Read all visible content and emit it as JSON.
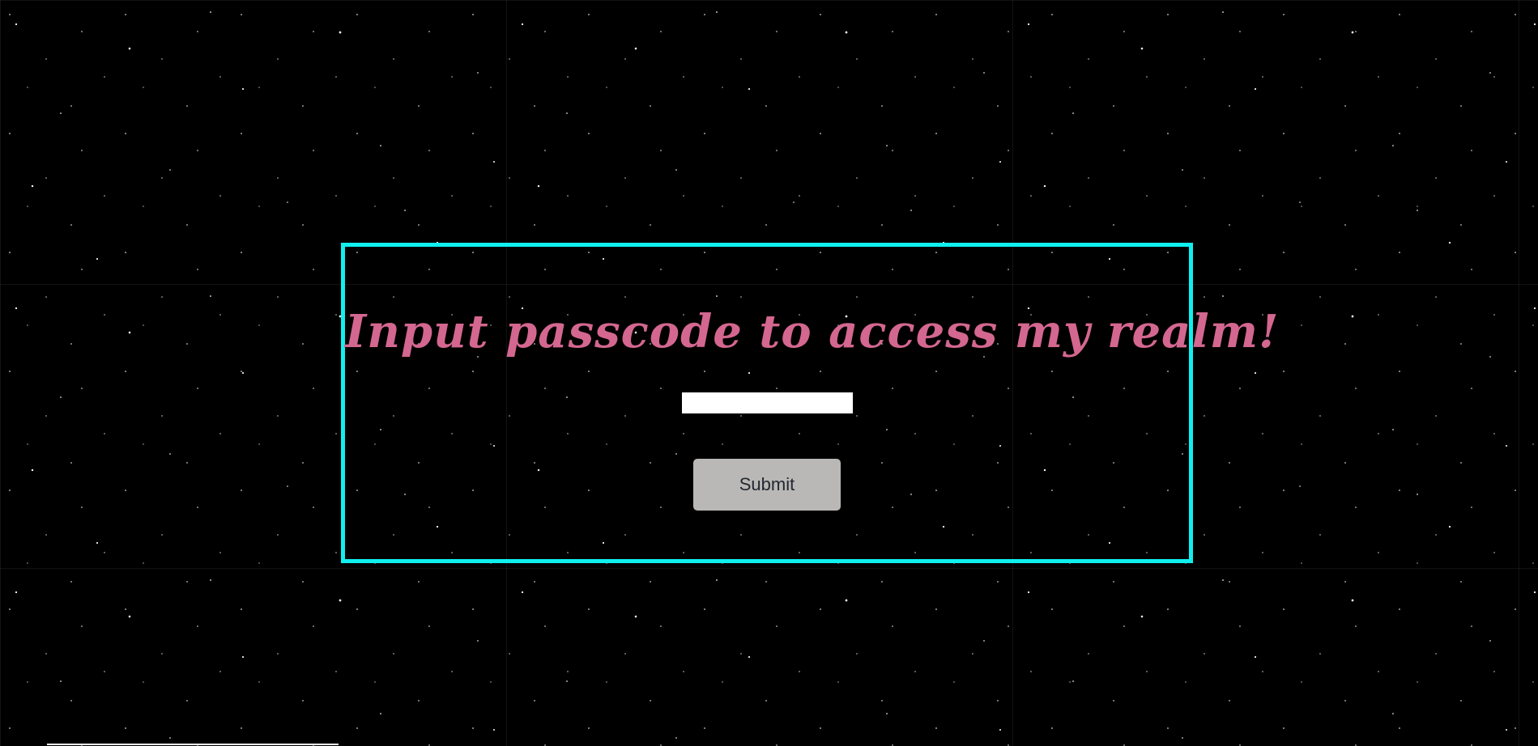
{
  "login": {
    "heading": "Input passcode to access my realm!",
    "passcode_value": "",
    "submit_label": "Submit"
  },
  "colors": {
    "background": "#000000",
    "panel_border": "#0ff0ef",
    "heading_text": "#d4678f",
    "button_background": "#bab8b6",
    "button_text": "#222831"
  }
}
